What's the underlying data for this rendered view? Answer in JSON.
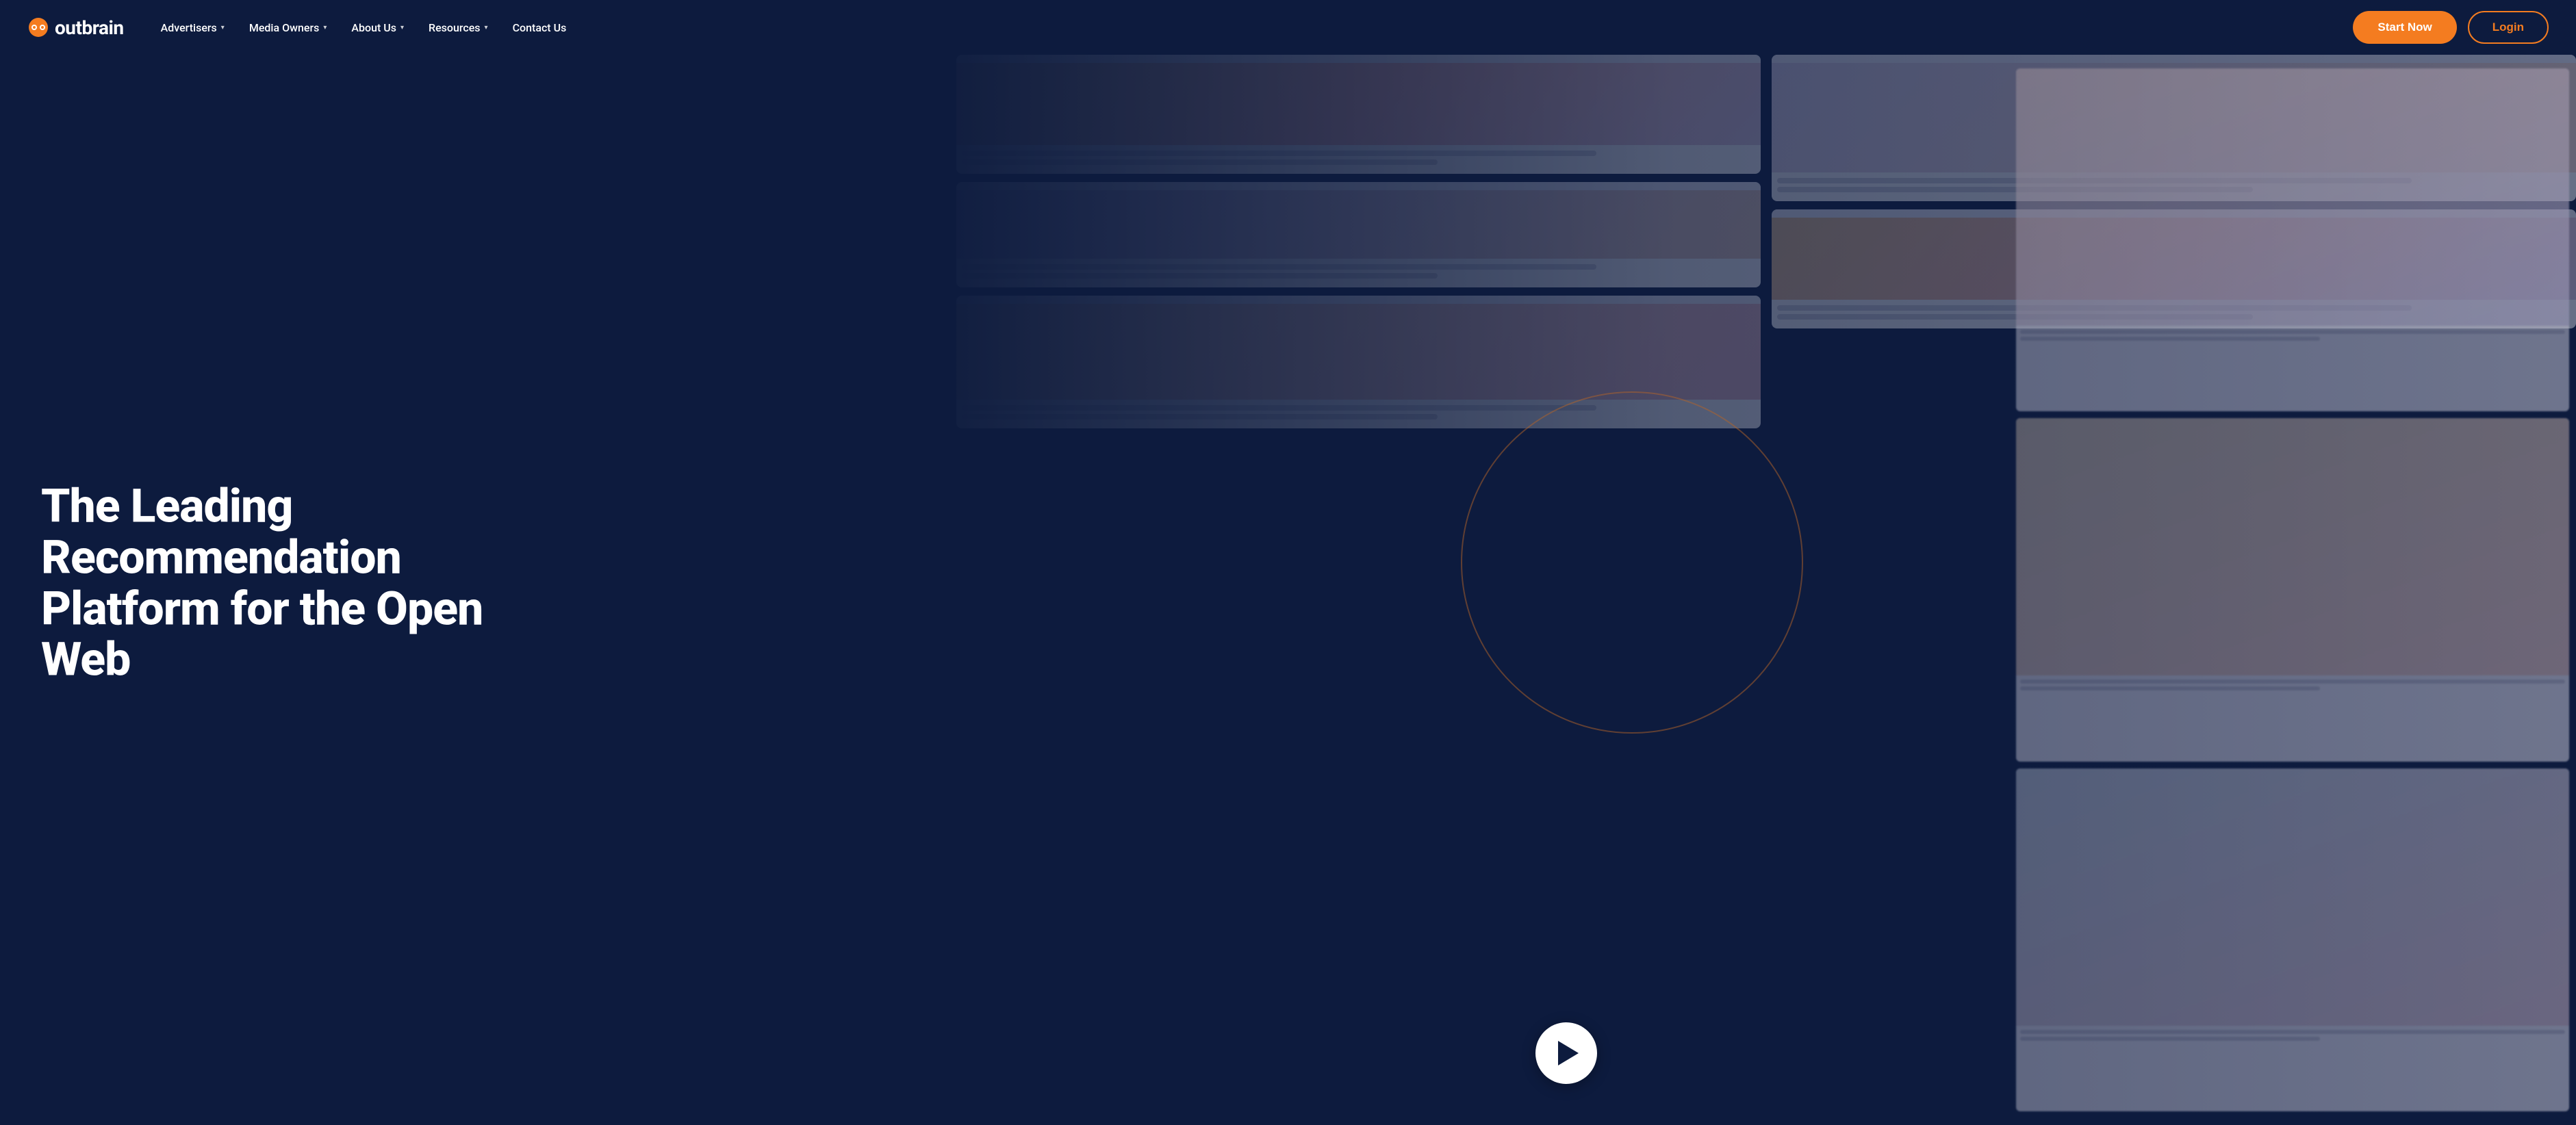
{
  "logo": {
    "text": "outbrain",
    "aria": "Outbrain logo"
  },
  "nav": {
    "items": [
      {
        "label": "Advertisers",
        "hasDropdown": true
      },
      {
        "label": "Media Owners",
        "hasDropdown": true
      },
      {
        "label": "About Us",
        "hasDropdown": true
      },
      {
        "label": "Resources",
        "hasDropdown": true
      },
      {
        "label": "Contact Us",
        "hasDropdown": false
      }
    ],
    "actions": {
      "start_label": "Start Now",
      "login_label": "Login"
    }
  },
  "hero": {
    "title": "The Leading Recommendation Platform for the Open Web"
  },
  "colors": {
    "background": "#0d1b3e",
    "accent": "#f47c20",
    "text_white": "#ffffff"
  }
}
